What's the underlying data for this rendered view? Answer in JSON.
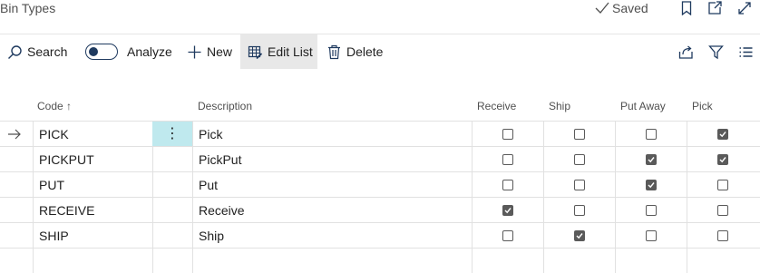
{
  "header": {
    "title": "Bin Types",
    "saved_label": "Saved"
  },
  "toolbar": {
    "search_label": "Search",
    "analyze_label": "Analyze",
    "new_label": "New",
    "edit_list_label": "Edit List",
    "delete_label": "Delete"
  },
  "columns": {
    "code": "Code",
    "description": "Description",
    "receive": "Receive",
    "ship": "Ship",
    "put_away": "Put Away",
    "pick": "Pick"
  },
  "rows": [
    {
      "code": "PICK",
      "description": "Pick",
      "receive": false,
      "ship": false,
      "put_away": false,
      "pick": true
    },
    {
      "code": "PICKPUT",
      "description": "PickPut",
      "receive": false,
      "ship": false,
      "put_away": true,
      "pick": true
    },
    {
      "code": "PUT",
      "description": "Put",
      "receive": false,
      "ship": false,
      "put_away": true,
      "pick": false
    },
    {
      "code": "RECEIVE",
      "description": "Receive",
      "receive": true,
      "ship": false,
      "put_away": false,
      "pick": false
    },
    {
      "code": "SHIP",
      "description": "Ship",
      "receive": false,
      "ship": true,
      "put_away": false,
      "pick": false
    }
  ],
  "icons": {
    "title_bar": [
      "bookmark-icon",
      "open-in-new-window-icon",
      "expand-icon"
    ],
    "toolbar_right": [
      "share-icon",
      "filter-icon",
      "list-view-icon"
    ]
  },
  "colors": {
    "accent_selected_cell": "#bfe9ee",
    "icon_blue": "#1f3a5f",
    "active_button_bg": "#e8e8e8"
  }
}
